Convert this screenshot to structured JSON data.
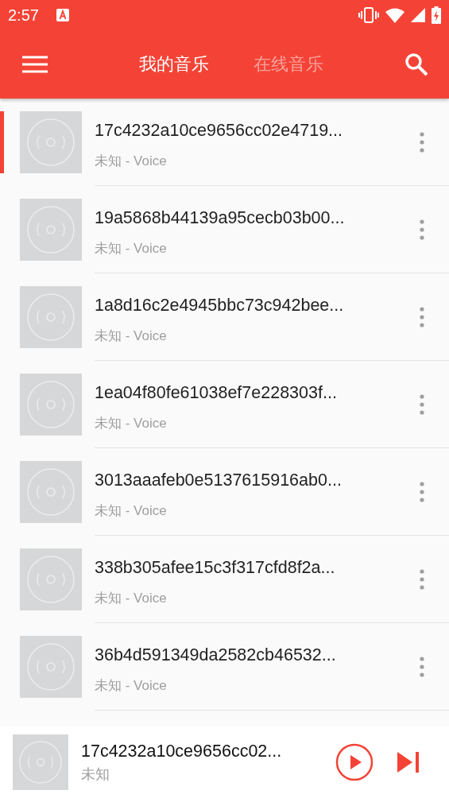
{
  "status_bar": {
    "time": "2:57"
  },
  "toolbar": {
    "tabs": [
      {
        "label": "我的音乐",
        "selected": true
      },
      {
        "label": "在线音乐",
        "selected": false
      }
    ]
  },
  "songs": [
    {
      "title": "17c4232a10ce9656cc02e4719...",
      "subtitle": "未知 - Voice",
      "selected": true
    },
    {
      "title": "19a5868b44139a95cecb03b00...",
      "subtitle": "未知 - Voice",
      "selected": false
    },
    {
      "title": "1a8d16c2e4945bbc73c942bee...",
      "subtitle": "未知 - Voice",
      "selected": false
    },
    {
      "title": "1ea04f80fe61038ef7e228303f...",
      "subtitle": "未知 - Voice",
      "selected": false
    },
    {
      "title": "3013aaafeb0e5137615916ab0...",
      "subtitle": "未知 - Voice",
      "selected": false
    },
    {
      "title": "338b305afee15c3f317cfd8f2a...",
      "subtitle": "未知 - Voice",
      "selected": false
    },
    {
      "title": "36b4d591349da2582cb46532...",
      "subtitle": "未知 - Voice",
      "selected": false
    }
  ],
  "player": {
    "title": "17c4232a10ce9656cc02...",
    "subtitle": "未知",
    "playing": false
  }
}
